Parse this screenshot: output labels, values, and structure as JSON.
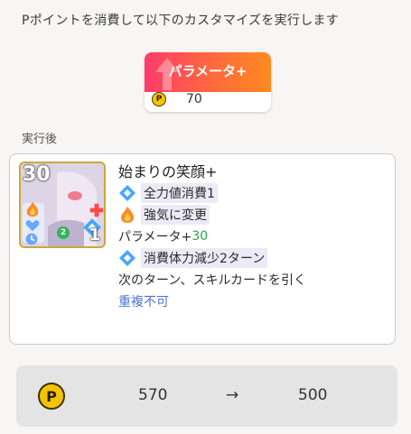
{
  "header": {
    "text": "Pポイントを消費して以下のカスタマイズを実行します"
  },
  "custom_option": {
    "label": "パラメータ+",
    "cost": "70",
    "coin_letter": "P",
    "gradient_colors": [
      "#ff3b6b",
      "#ff8a20"
    ]
  },
  "after": {
    "label": "実行後"
  },
  "card": {
    "cost": "30",
    "bottom_number": "1",
    "badge_number": "2",
    "title": "始まりの笑顔+",
    "effects": {
      "line1": "全力値消費1",
      "line2": "強気に変更",
      "line3_prefix": "パラメータ+",
      "line3_value": "30",
      "line4": "消費体力減少2ターン",
      "line5": "次のターン、スキルカードを引く",
      "line6": "重複不可"
    },
    "effect_icon_names": [
      "blue-diamond-icon",
      "flame-icon",
      "blue-diamond-icon"
    ]
  },
  "points": {
    "coin_letter": "P",
    "from": "570",
    "arrow": "→",
    "to": "500"
  }
}
